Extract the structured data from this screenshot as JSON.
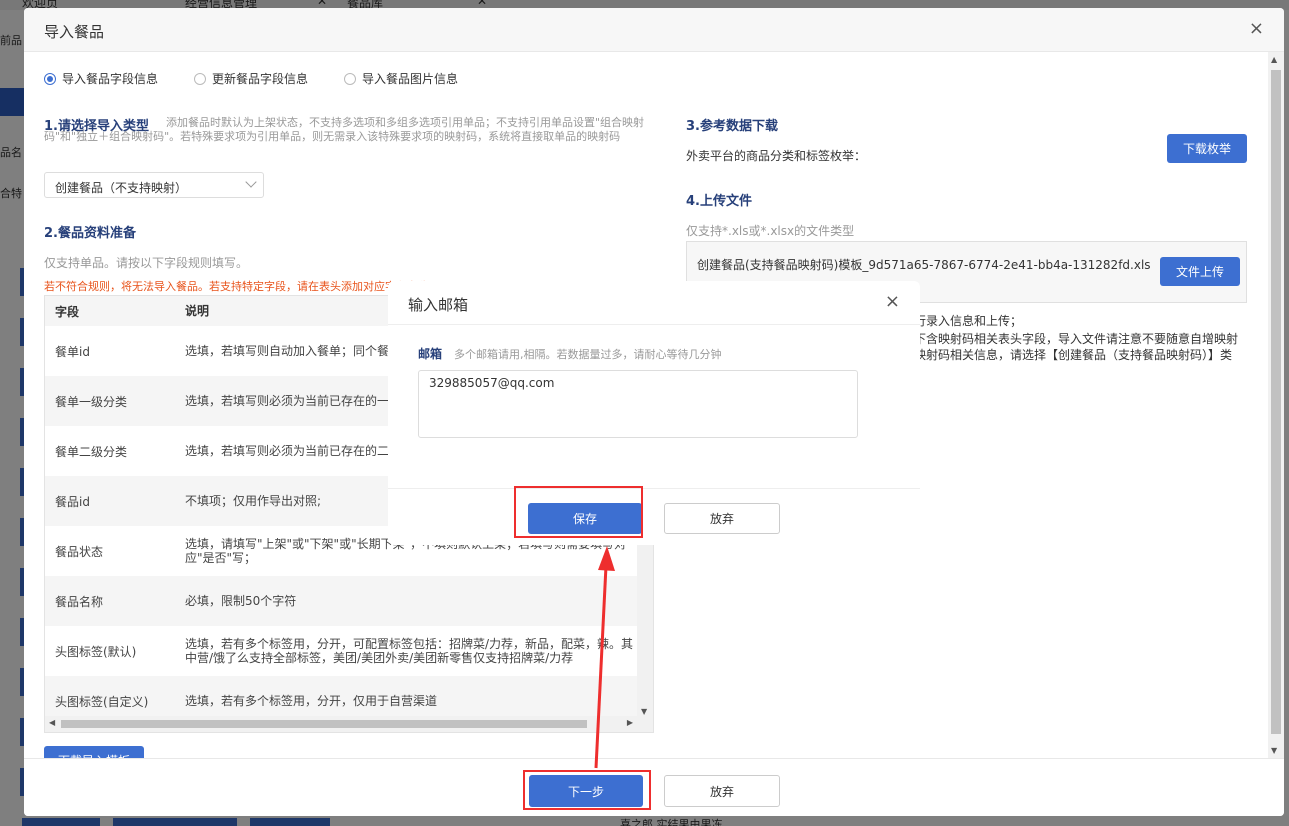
{
  "bg_tabs": [
    {
      "label": "欢迎页"
    },
    {
      "label": "经营信息管理"
    },
    {
      "label": "餐品库"
    }
  ],
  "bg_side": [
    "前品",
    "品名",
    "合特"
  ],
  "bg_bottom_text": "喜之郎 实结果由果冻",
  "dialog": {
    "title": "导入餐品",
    "close": "×",
    "radios": [
      {
        "label": "导入餐品字段信息",
        "checked": true
      },
      {
        "label": "更新餐品字段信息",
        "checked": false
      },
      {
        "label": "导入餐品图片信息",
        "checked": false
      }
    ],
    "section1": {
      "title": "1.请选择导入类型",
      "desc": "添加餐品时默认为上架状态，不支持多选项和多组多选项引用单品；不支持引用单品设置\"组合映射码\"和\"独立＋组合映射码\"。若特殊要求项为引用单品，则无需录入该特殊要求项的映射码，系统将直接取单品的映射码",
      "select_value": "创建餐品（不支持映射）"
    },
    "section2": {
      "title": "2.餐品资料准备",
      "desc": "仅支持单品。请按以下字段规则填写。",
      "warning": "若不符合规则，将无法导入餐品。若支持特定字段，请在表头添加对应字段名称",
      "table_header": {
        "field": "字段",
        "desc": "说明"
      },
      "table_rows": [
        {
          "field": "餐单id",
          "desc": "选填，若填写则自动加入餐单；同个餐"
        },
        {
          "field": "餐单一级分类",
          "desc": "选填，若填写则必须为当前已存在的一"
        },
        {
          "field": "餐单二级分类",
          "desc": "选填，若填写则必须为当前已存在的二"
        },
        {
          "field": "餐品id",
          "desc": "不填项；仅用作导出对照;"
        },
        {
          "field": "餐品状态",
          "desc": "选填，请填写\"上架\"或\"下架\"或\"长期下架\"，不填则默认上架；若填写则需要填写对应\"是否\"写；"
        },
        {
          "field": "餐品名称",
          "desc": "必填，限制50个字符"
        },
        {
          "field": "头图标签(默认)",
          "desc": "选填，若有多个标签用，分开，可配置标签包括：招牌菜/力荐，新品，配菜，辣。其中营/饿了么支持全部标签，美团/美团外卖/美团新零售仅支持招牌菜/力荐"
        },
        {
          "field": "头图标签(自定义)",
          "desc": "选填，若有多个标签用，分开，仅用于自营渠道"
        }
      ],
      "download_template": "下载导入模板"
    },
    "section3": {
      "title": "3.参考数据下载",
      "desc": "外卖平台的商品分类和标签枚举：",
      "button": "下载枚举"
    },
    "section4": {
      "title": "4.上传文件",
      "desc": "仅支持*.xls或*.xlsx的文件类型",
      "file_name": "创建餐品(支持餐品映射码)模板_9d571a65-7867-6774-2e41-bb4a-131282fd.xls",
      "upload_button": "文件上传",
      "notes": [
        "行录入信息和上传；",
        "下含映射码相关表头字段，导入文件请注意不要随意自增映射",
        "映射码相关信息，请选择【创建餐品（支持餐品映射码）】类"
      ]
    },
    "footer": {
      "next": "下一步",
      "cancel": "放弃"
    }
  },
  "email_modal": {
    "title": "输入邮箱",
    "close": "×",
    "label": "邮箱",
    "hint": "多个邮箱请用,相隔。若数据量过多，请耐心等待几分钟",
    "value": "329885057@qq.com",
    "save": "保存",
    "cancel": "放弃"
  },
  "colors": {
    "primary": "#3d6fd1",
    "highlight": "#ee2e2e",
    "section_title": "#27407a",
    "warning": "#e8541c"
  }
}
